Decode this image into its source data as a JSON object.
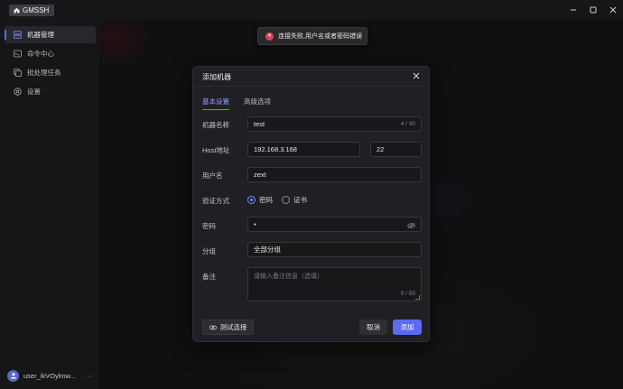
{
  "app": {
    "title": "GMSSH"
  },
  "window_controls": {
    "minimize": "─",
    "maximize": "☐",
    "close": "✕"
  },
  "sidebar": {
    "items": [
      {
        "label": "机器管理",
        "icon": "server-icon",
        "active": true
      },
      {
        "label": "命令中心",
        "icon": "terminal-icon",
        "active": false
      },
      {
        "label": "批处理任务",
        "icon": "batch-icon",
        "active": false
      },
      {
        "label": "设置",
        "icon": "gear-icon",
        "active": false
      }
    ],
    "user": {
      "name": "user_ikVOylmw...",
      "more": "···"
    }
  },
  "toast": {
    "message": "连接失败,用户名或者密码错误",
    "icon": "×"
  },
  "dialog": {
    "title": "添加机器",
    "close": "✕",
    "tabs": [
      {
        "label": "基本设置",
        "active": true
      },
      {
        "label": "高级选项",
        "active": false
      }
    ],
    "fields": {
      "name": {
        "label": "机器名称",
        "value": "test",
        "count": "4 / 30"
      },
      "host": {
        "label": "Host地址",
        "value": "192.168.3.168",
        "port": "22"
      },
      "user": {
        "label": "用户名",
        "value": "zext"
      },
      "auth": {
        "label": "验证方式",
        "options": [
          "密码",
          "证书"
        ],
        "selected": "密码"
      },
      "password": {
        "label": "密码",
        "value": "•"
      },
      "group": {
        "label": "分组",
        "value": "全部分组"
      },
      "note": {
        "label": "备注",
        "placeholder": "请输入备注信息（选填）",
        "count": "0 / 50"
      }
    },
    "buttons": {
      "test": "测试连接",
      "cancel": "取消",
      "add": "添加"
    }
  },
  "colors": {
    "accent": "#5b6af2",
    "error": "#e0414f"
  }
}
